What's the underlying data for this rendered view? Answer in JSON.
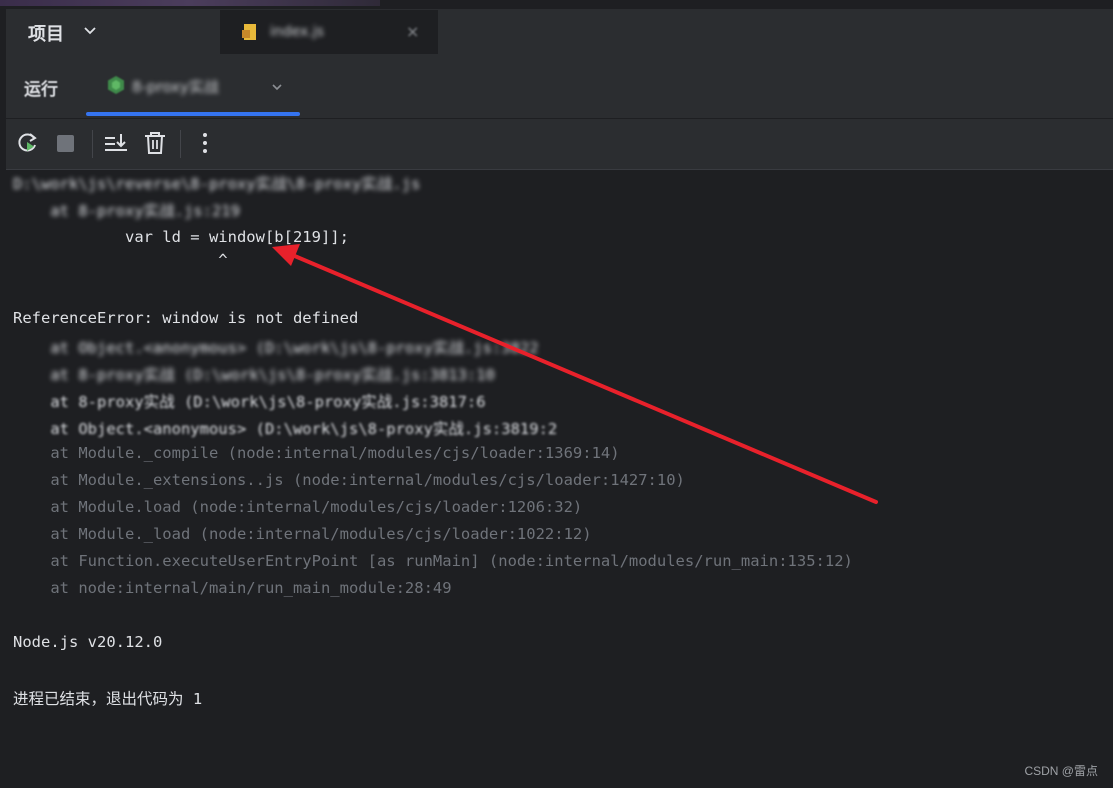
{
  "header": {
    "project_label": "项目",
    "file_tab_name": "index.js",
    "run_label": "运行",
    "run_config_name": "8-proxy实战"
  },
  "console": {
    "lines": [
      "D:\\work\\js\\reverse\\8-proxy实战\\8-proxy实战.js",
      "    at 8-proxy实战.js:219",
      "            var ld = window[b[219]];",
      "                      ^",
      "",
      "ReferenceError: window is not defined",
      "    at Object.<anonymous> (D:\\work\\js\\8-proxy实战.js:3822",
      "    at 8-proxy实战 (D:\\work\\js\\8-proxy实战.js:3813:10",
      "    at 8-proxy实战 (D:\\work\\js\\8-proxy实战.js:3817:6",
      "    at Object.<anonymous> (D:\\work\\js\\8-proxy实战.js:3819:2",
      "    at Module._compile (node:internal/modules/cjs/loader:1369:14)",
      "    at Module._extensions..js (node:internal/modules/cjs/loader:1427:10)",
      "    at Module.load (node:internal/modules/cjs/loader:1206:32)",
      "    at Module._load (node:internal/modules/cjs/loader:1022:12)",
      "    at Function.executeUserEntryPoint [as runMain] (node:internal/modules/run_main:135:12)",
      "    at node:internal/main/run_main_module:28:49",
      "",
      "Node.js v20.12.0",
      "",
      "进程已结束，退出代码为 1"
    ]
  },
  "watermark": "CSDN @雷点",
  "colors": {
    "accent": "#3574f0",
    "arrow": "#e8212b",
    "run_icon_green": "#5fb865"
  }
}
